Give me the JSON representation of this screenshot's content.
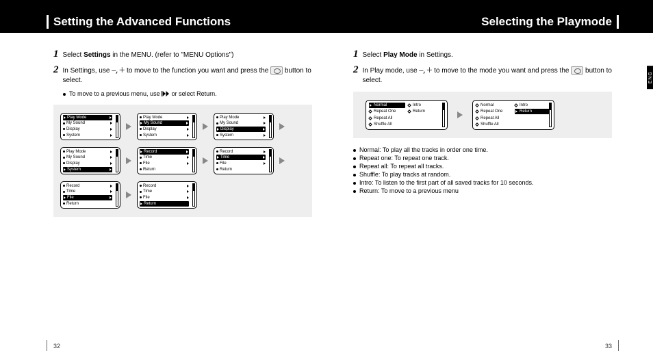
{
  "header": {
    "left_title": "Setting the Advanced Functions",
    "right_title": "Selecting the Playmode"
  },
  "tab": {
    "label": "ENG"
  },
  "left": {
    "step1_num": "1",
    "step1_a": "Select ",
    "step1_bold": "Settings",
    "step1_b": " in the MENU. (refer to \"MENU Options\")",
    "step2_num": "2",
    "step2_a": "In Settings, use ",
    "step2_mp": "—,＋",
    "step2_b": " to move to the function you want and press the ",
    "step2_c": " button to select.",
    "note_a": "To move to a previous menu, use ",
    "note_b": " or select Return.",
    "menu": {
      "play_mode": "Play Mode",
      "my_sound": "My Sound",
      "display": "Display",
      "system": "System",
      "record": "Record",
      "time": "Time",
      "file": "File",
      "return": "Return"
    }
  },
  "right": {
    "step1_num": "1",
    "step1_a": "Select ",
    "step1_bold": "Play Mode",
    "step1_b": " in Settings.",
    "step2_num": "2",
    "step2_a": "In Play mode, use ",
    "step2_mp": "—,＋",
    "step2_b": " to move to the mode you want and press the ",
    "step2_c": " button to select.",
    "menu": {
      "normal": "Normal",
      "repeat_one": "Repeat One",
      "repeat_all": "Repeat All",
      "shuffle_all": "Shuffle All",
      "intro": "Intro",
      "return": "Return"
    },
    "defs": {
      "normal": "Normal: To play all the tracks in order one time.",
      "repeat_one": "Repeat one: To repeat one track.",
      "repeat_all": "Repeat all: To repeat all tracks.",
      "shuffle": "Shuffle: To play tracks at random.",
      "intro": "Intro: To listen to the first part of all saved tracks for 10 seconds.",
      "return": "Return: To move to a previous menu"
    }
  },
  "pagenum": {
    "left": "32",
    "right": "33"
  }
}
